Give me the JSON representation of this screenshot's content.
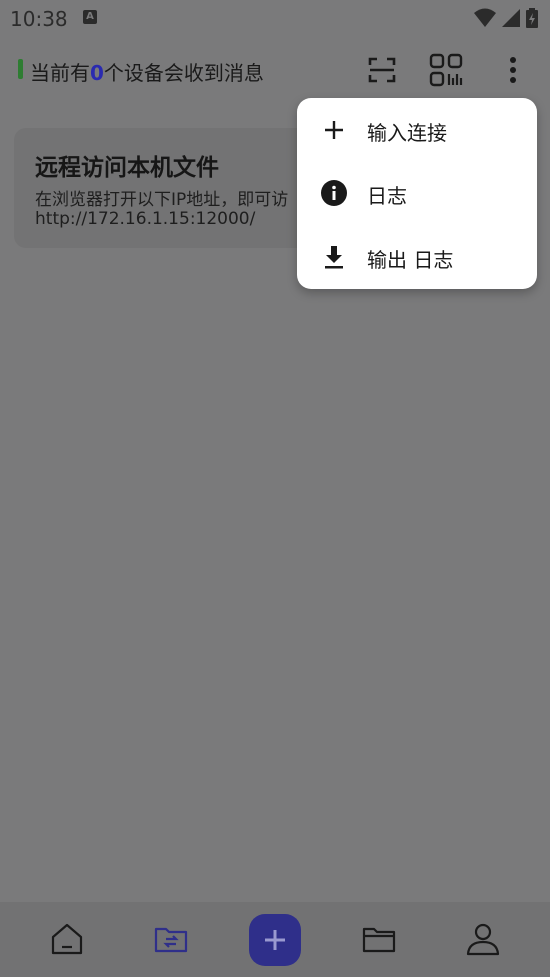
{
  "status_bar": {
    "time": "10:38",
    "notification_badge": "A"
  },
  "app_bar": {
    "status_prefix": "当前有",
    "device_count": "0",
    "status_suffix": "个设备会收到消息",
    "indicator_color": "#2e7d32"
  },
  "card": {
    "title": "远程访问本机文件",
    "description": "在浏览器打开以下IP地址，即可访",
    "url": "http://172.16.1.15:12000/"
  },
  "menu": {
    "items": [
      {
        "label": "输入连接",
        "icon": "plus-icon"
      },
      {
        "label": "日志",
        "icon": "info-icon"
      },
      {
        "label": "输出 日志",
        "icon": "download-icon"
      }
    ]
  },
  "bottom_nav": {
    "items": [
      {
        "icon": "home-icon"
      },
      {
        "icon": "folder-transfer-icon",
        "active": true
      },
      {
        "icon": "add-icon"
      },
      {
        "icon": "folder-icon"
      },
      {
        "icon": "profile-icon"
      }
    ],
    "accent_color": "#2f2f8a"
  }
}
